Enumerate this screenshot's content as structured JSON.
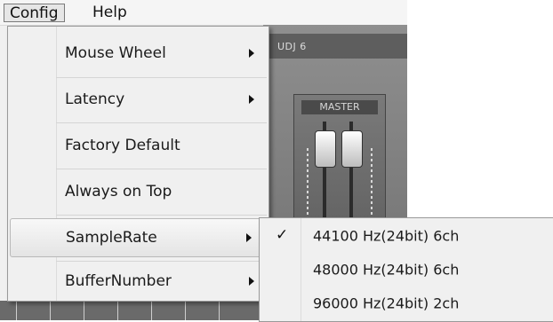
{
  "menubar": {
    "config": "Config",
    "help": "Help"
  },
  "device": {
    "strip_label": "UDJ 6",
    "master_label": "MASTER"
  },
  "config_menu": {
    "items": [
      {
        "label": "Mouse Wheel",
        "submenu": true
      },
      {
        "label": "Latency",
        "submenu": true
      },
      {
        "label": "Factory Default",
        "submenu": false
      },
      {
        "label": "Always on Top",
        "submenu": false
      },
      {
        "label": "SampleRate",
        "submenu": true,
        "highlighted": true
      },
      {
        "label": "BufferNumber",
        "submenu": true
      }
    ]
  },
  "samplerate_menu": {
    "items": [
      {
        "label": "44100 Hz(24bit) 6ch",
        "checked": true
      },
      {
        "label": "48000 Hz(24bit) 6ch",
        "checked": false
      },
      {
        "label": "96000 Hz(24bit) 2ch",
        "checked": false
      }
    ],
    "check_glyph": "✓"
  }
}
